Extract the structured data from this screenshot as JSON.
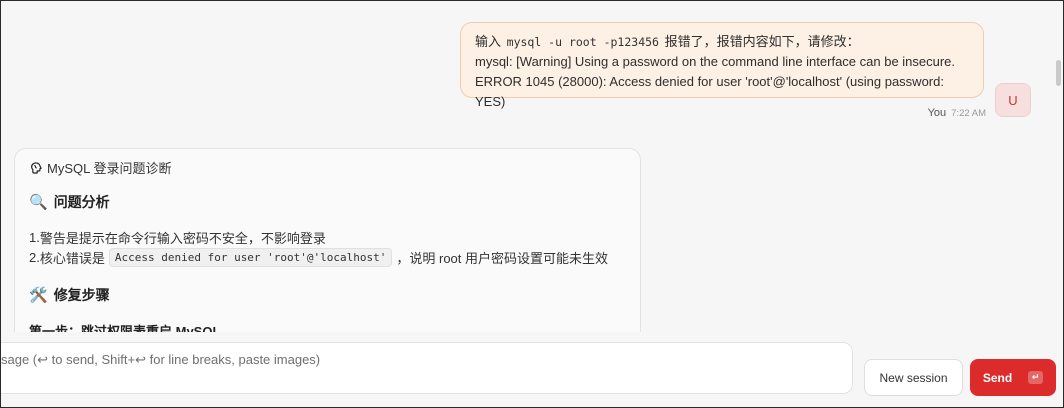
{
  "user_message": {
    "line1_prefix": "输入",
    "line1_code": "mysql -u root -p123456",
    "line1_suffix": "报错了，报错内容如下，请修改：",
    "line2": "mysql: [Warning] Using a password on the command line interface can be insecure.",
    "line3": "ERROR 1045 (28000): Access denied for user 'root'@'localhost' (using password: YES)",
    "sender": "You",
    "time": "7:22 AM",
    "avatar_letter": "U"
  },
  "assistant": {
    "header_icon": "brain-icon",
    "header_title": "MySQL 登录问题诊断",
    "section1": {
      "emoji": "🔍",
      "title": "问题分析"
    },
    "items": [
      {
        "num": "1.",
        "text": "警告是提示在命令行输入密码不安全，不影响登录"
      },
      {
        "num": "2.",
        "text_before": "核心错误是",
        "code": "Access denied for user 'root'@'localhost'",
        "text_after": "，说明 root 用户密码设置可能未生效"
      }
    ],
    "section2": {
      "emoji": "🛠️",
      "title": "修复步骤"
    },
    "step1_title": "第一步：跳过权限表重启 MySQL"
  },
  "composer": {
    "placeholder": "sage (↩ to send, Shift+↩ for line breaks, paste images)",
    "new_session_label": "New session",
    "send_label": "Send",
    "send_icon": "enter-icon",
    "send_icon_glyph": "↵"
  },
  "colors": {
    "accent": "#dc2b2b",
    "user_bubble_bg": "#fdf0e4",
    "user_bubble_border": "#f0ccb0",
    "avatar_bg": "#f7dfdf"
  }
}
